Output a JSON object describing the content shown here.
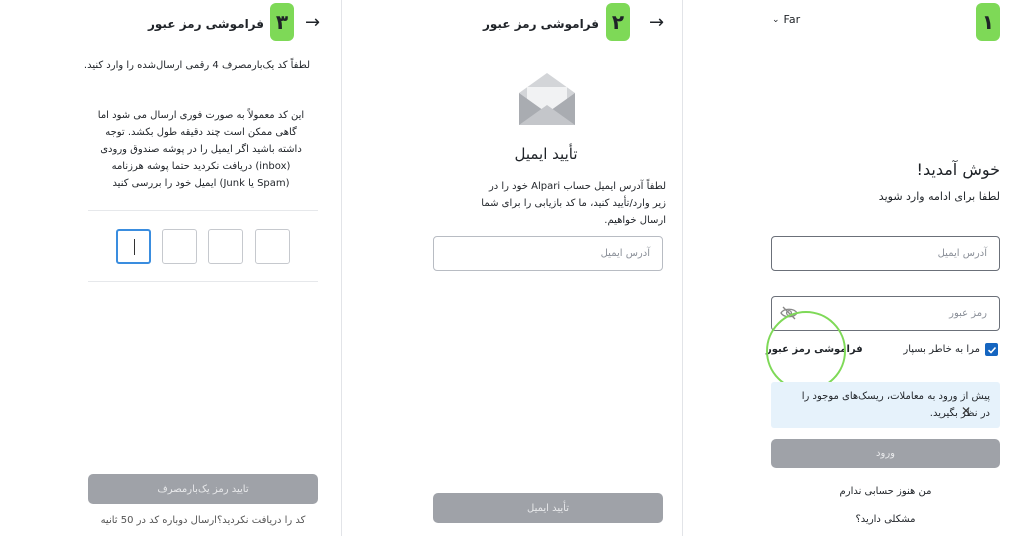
{
  "panel3": {
    "step": "۳",
    "title": "فراموشی رمز عبور",
    "instruction": "لطفاً کد یک‌بارمصرف 4 رقمی ارسال‌شده را وارد کنید.",
    "note": "این کد معمولاً به صورت فوری ارسال می شود اما گاهی ممکن است چند دقیقه طول بکشد. توجه داشته باشید اگر ایمیل را در پوشه صندوق ورودی (inbox) دریافت نکردید حتما پوشه هرزنامه (Spam یا Junk) ایمیل خود را بررسی کنید",
    "otp_digits": [
      "",
      "",
      "",
      ""
    ],
    "confirm_button": "تایید رمز یک‌بارمصرف",
    "resend_text": "کد را دریافت نکردید؟ارسال دوباره کد در 50 ثانیه"
  },
  "panel2": {
    "step": "۲",
    "title": "فراموشی رمز عبور",
    "heading": "تأیید ایمیل",
    "description": "لطفاً آدرس ایمیل حساب Alpari خود را در زیر وارد/تأیید کنید، ما کد بازیابی را برای شما ارسال خواهیم.",
    "email_placeholder": "آدرس ایمیل",
    "confirm_button": "تأیید ایمیل"
  },
  "panel1": {
    "step": "۱",
    "language": "Far",
    "welcome": "خوش آمدید!",
    "subtitle": "لطفا برای ادامه وارد شوید",
    "email_placeholder": "آدرس ایمیل",
    "password_placeholder": "رمز عبور",
    "remember_me": "مرا به خاطر بسپار",
    "remember_checked": true,
    "forgot_password": "فراموشی رمز عبور",
    "risk_notice": "پیش از ورود به معاملات، ریسک‌های موجود را در نظر بگیرید.",
    "login_button": "ورود",
    "no_account": "من هنوز حسابی ندارم",
    "help": "مشکلی دارید؟"
  },
  "colors": {
    "step_badge": "#7ed957",
    "highlight_circle": "#7ed957",
    "checkbox": "#1565c0",
    "notice_bg": "#e6f2fb",
    "disabled_button": "#9fa2a8"
  }
}
